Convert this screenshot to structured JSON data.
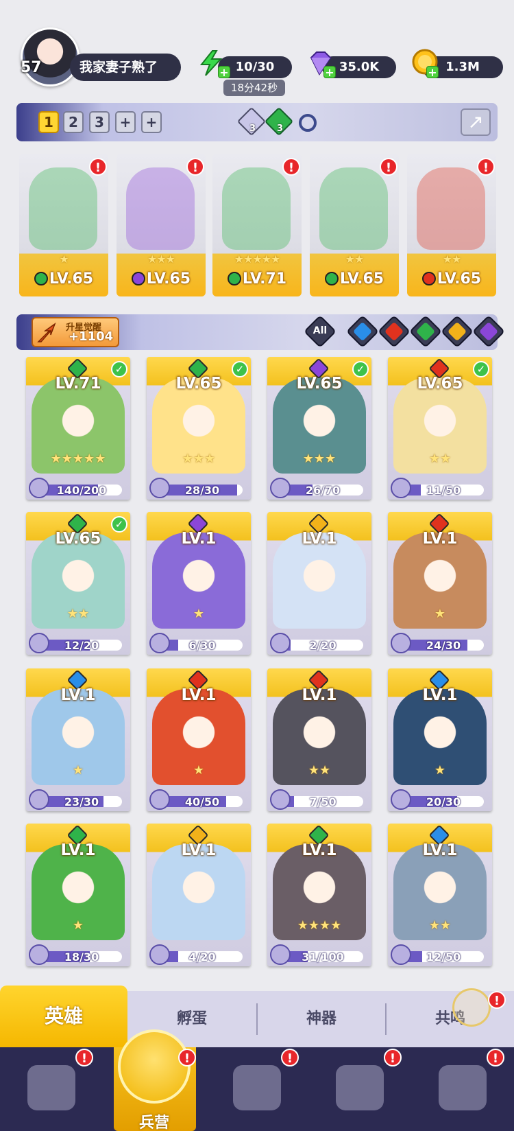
{
  "player": {
    "level": "57",
    "name": "我家妻子熟了"
  },
  "resources": {
    "energy": {
      "value": "10/30",
      "timer": "18分42秒",
      "icon": "lightning-icon",
      "color": "#39d94b"
    },
    "gems": {
      "value": "35.0K",
      "icon": "diamond-icon",
      "color": "#8e5be6"
    },
    "gold": {
      "value": "1.3M",
      "icon": "coin-icon",
      "color": "#ffc21a"
    }
  },
  "team_bar": {
    "tabs": [
      "1",
      "2",
      "3",
      "+",
      "+"
    ],
    "active_tab": 0,
    "gem_counts": [
      "3",
      "3"
    ]
  },
  "team": [
    {
      "level": "LV.65",
      "stars": "★",
      "element": "nature",
      "alert": "!"
    },
    {
      "level": "LV.65",
      "stars": "★★★",
      "element": "shadow",
      "alert": "!"
    },
    {
      "level": "LV.71",
      "stars": "★★★★★",
      "element": "nature",
      "alert": "!"
    },
    {
      "level": "LV.65",
      "stars": "★★",
      "element": "nature",
      "alert": "!"
    },
    {
      "level": "LV.65",
      "stars": "★★",
      "element": "fire",
      "alert": "!"
    }
  ],
  "awaken": {
    "label": "升星觉醒",
    "value": "+1104"
  },
  "filters": {
    "all_label": "All",
    "elements": [
      "water",
      "fire",
      "nature",
      "light",
      "shadow"
    ]
  },
  "element_colors": {
    "nature": "#2fb34a",
    "shadow": "#8b46d8",
    "fire": "#e0321e",
    "water": "#2a8ee8",
    "light": "#f2b21a"
  },
  "heroes": [
    {
      "level": "LV.71",
      "element": "nature",
      "stars": "★★★★★",
      "fragments": "140/200",
      "progress": 0.7,
      "checked": true,
      "tint": "#8cc56a"
    },
    {
      "level": "LV.65",
      "element": "nature",
      "stars": "★★★",
      "fragments": "28/30",
      "progress": 0.93,
      "checked": true,
      "tint": "#ffe28a"
    },
    {
      "level": "LV.65",
      "element": "shadow",
      "stars": "★★★",
      "fragments": "26/70",
      "progress": 0.37,
      "checked": true,
      "tint": "#5a8f90"
    },
    {
      "level": "LV.65",
      "element": "fire",
      "stars": "★★",
      "fragments": "11/50",
      "progress": 0.22,
      "checked": true,
      "tint": "#f3e0a0"
    },
    {
      "level": "LV.65",
      "element": "nature",
      "stars": "★★",
      "fragments": "12/20",
      "progress": 0.6,
      "checked": true,
      "tint": "#9fd4c9"
    },
    {
      "level": "LV.1",
      "element": "shadow",
      "stars": "★",
      "fragments": "6/30",
      "progress": 0.2,
      "checked": false,
      "tint": "#8a6bd8"
    },
    {
      "level": "LV.1",
      "element": "light",
      "stars": "",
      "fragments": "2/20",
      "progress": 0.1,
      "checked": false,
      "tint": "#d4e2f5"
    },
    {
      "level": "LV.1",
      "element": "fire",
      "stars": "★",
      "fragments": "24/30",
      "progress": 0.8,
      "checked": false,
      "tint": "#c78b5e"
    },
    {
      "level": "LV.1",
      "element": "water",
      "stars": "★",
      "fragments": "23/30",
      "progress": 0.77,
      "checked": false,
      "tint": "#9fc8ea"
    },
    {
      "level": "LV.1",
      "element": "fire",
      "stars": "★",
      "fragments": "40/50",
      "progress": 0.8,
      "checked": false,
      "tint": "#e2502e"
    },
    {
      "level": "LV.1",
      "element": "fire",
      "stars": "★★",
      "fragments": "7/50",
      "progress": 0.14,
      "checked": false,
      "tint": "#55535e"
    },
    {
      "level": "LV.1",
      "element": "water",
      "stars": "★",
      "fragments": "20/30",
      "progress": 0.67,
      "checked": false,
      "tint": "#2f4f74"
    },
    {
      "level": "LV.1",
      "element": "nature",
      "stars": "★",
      "fragments": "18/30",
      "progress": 0.6,
      "checked": false,
      "tint": "#4fb34a"
    },
    {
      "level": "LV.1",
      "element": "light",
      "stars": "",
      "fragments": "4/20",
      "progress": 0.2,
      "checked": false,
      "tint": "#bcd7f2"
    },
    {
      "level": "LV.1",
      "element": "nature",
      "stars": "★★★★",
      "fragments": "31/100",
      "progress": 0.31,
      "checked": false,
      "tint": "#6a5e66"
    },
    {
      "level": "LV.1",
      "element": "water",
      "stars": "★★",
      "fragments": "12/50",
      "progress": 0.24,
      "checked": false,
      "tint": "#8aa0b8"
    }
  ],
  "sub_tabs": [
    "英雄",
    "孵蛋",
    "神器",
    "共鸣"
  ],
  "nav": {
    "active_label": "兵营",
    "alert": "!"
  }
}
